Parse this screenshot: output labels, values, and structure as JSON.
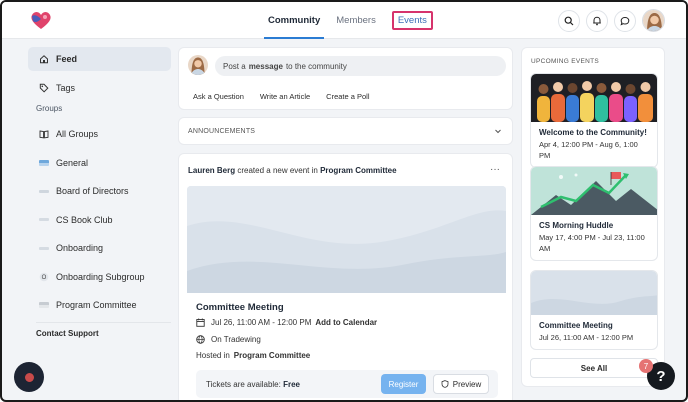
{
  "header": {
    "nav": [
      {
        "label": "Community",
        "active": true
      },
      {
        "label": "Members",
        "active": false
      },
      {
        "label": "Events",
        "active": false,
        "highlighted": true
      }
    ],
    "icons": [
      "search-icon",
      "bell-icon",
      "chat-icon"
    ]
  },
  "sidebar": {
    "feed": "Feed",
    "tags": "Tags",
    "groups_label": "Groups",
    "groups": [
      {
        "label": "All Groups",
        "icon": "book-icon"
      },
      {
        "label": "General",
        "icon": "flag-chip"
      },
      {
        "label": "Board of Directors",
        "icon": "chip"
      },
      {
        "label": "CS Book Club",
        "icon": "chip"
      },
      {
        "label": "Onboarding",
        "icon": "chip"
      },
      {
        "label": "Onboarding Subgroup",
        "icon": "letter-o"
      },
      {
        "label": "Program Committee",
        "icon": "chip"
      }
    ],
    "contact": "Contact Support"
  },
  "composer": {
    "prefix": "Post a",
    "bold": "message",
    "suffix": "to the community",
    "actions": [
      "Ask a Question",
      "Write an Article",
      "Create a Poll"
    ]
  },
  "announcements": {
    "label": "ANNOUNCEMENTS"
  },
  "post": {
    "author": "Lauren Berg",
    "verb": "created a new event in",
    "group": "Program Committee",
    "more": "···",
    "event_title": "Committee Meeting",
    "datetime": "Jul 26, 11:00 AM - 12:00 PM",
    "add_calendar": "Add to Calendar",
    "location": "On Tradewing",
    "hosted_prefix": "Hosted in",
    "hosted_group": "Program Committee",
    "tickets_prefix": "Tickets are available:",
    "tickets_value": "Free",
    "register": "Register",
    "preview": "Preview"
  },
  "events": {
    "header": "UPCOMING EVENTS",
    "cards": [
      {
        "name": "Welcome to the Community!",
        "date": "Apr 4, 12:00 PM - Aug 6, 1:00 PM"
      },
      {
        "name": "CS Morning Huddle",
        "date": "May 17, 4:00 PM - Jul 23, 11:00 AM"
      },
      {
        "name": "Committee Meeting",
        "date": "Jul 26, 11:00 AM - 12:00 PM"
      }
    ],
    "see_all": "See All"
  },
  "help": {
    "label": "?",
    "badge": "7"
  },
  "colors": {
    "accent": "#2b7cd3",
    "register": "#76b3ef",
    "highlight": "#d6336c",
    "brand_logo": "#e0436b"
  }
}
